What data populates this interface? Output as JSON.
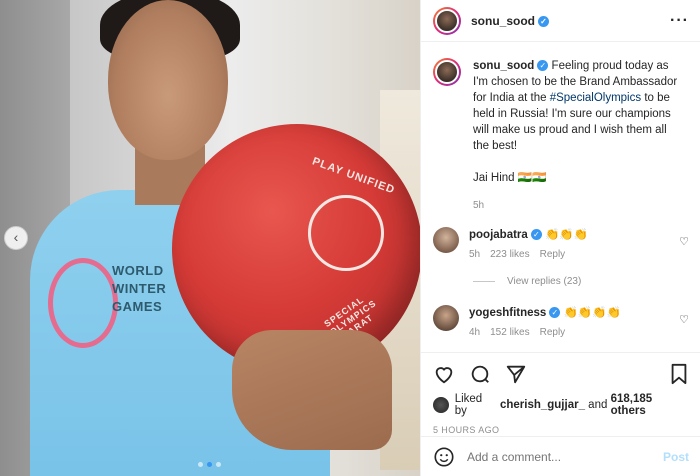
{
  "post": {
    "shirt_lines": [
      "WORLD",
      "WINTER",
      "GAMES"
    ],
    "ball_text_top": "PLAY UNIFIED",
    "ball_text_bottom": "SPECIAL OLYMPICS BHARAT",
    "carousel": {
      "prev_icon": "chevron-left-icon",
      "dots": 3,
      "active_dot": 1
    }
  },
  "header": {
    "username": "sonu_sood",
    "verified": true,
    "more_icon": "more-horizontal-icon"
  },
  "caption": {
    "username": "sonu_sood",
    "text_before": " Feeling proud today as I'm chosen to be the Brand Ambassador for India at the ",
    "hashtag": "#SpecialOlympics",
    "text_after": " to be held in Russia! I'm sure our champions will make us proud and I wish them all the best!",
    "signoff": "Jai Hind 🇮🇳🇮🇳",
    "time": "5h"
  },
  "comments": [
    {
      "username": "poojabatra",
      "text": "👏👏👏",
      "time": "5h",
      "likes": "223 likes",
      "reply": "Reply",
      "view_replies": "View replies (23)"
    },
    {
      "username": "yogeshfitness",
      "text": "👏👏👏👏",
      "time": "4h",
      "likes": "152 likes",
      "reply": "Reply"
    }
  ],
  "actions": {
    "liked_by_prefix": "Liked by ",
    "liked_by_user": "cherish_gujjar_",
    "liked_by_suffix": " and ",
    "likes_count": "618,185 others",
    "timestamp": "5 HOURS AGO"
  },
  "add_comment": {
    "placeholder": "Add a comment...",
    "post_label": "Post",
    "emoji_icon": "emoji-icon"
  },
  "colors": {
    "accent": "#3897f0",
    "hashtag": "#00376b",
    "post_disabled": "#b2dffc"
  }
}
